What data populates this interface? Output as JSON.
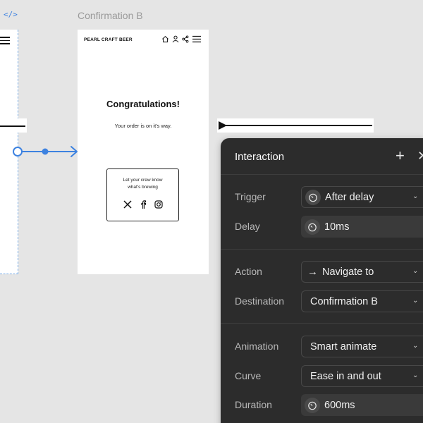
{
  "canvas": {
    "code_icon": "</>",
    "frame_label": "Confirmation B"
  },
  "phone": {
    "brand": "PEARL CRAFT BEER",
    "title": "Congratulations!",
    "subtitle": "Your order is on it's way.",
    "crew_line1": "Let your crew know",
    "crew_line2": "what's brewing",
    "nav_icons": [
      "home-icon",
      "user-icon",
      "share-icon",
      "menu-icon"
    ],
    "social_icons": [
      "x-icon",
      "facebook-icon",
      "instagram-icon"
    ]
  },
  "panel": {
    "title": "Interaction",
    "rows": {
      "trigger": {
        "label": "Trigger",
        "value": "After delay"
      },
      "delay": {
        "label": "Delay",
        "value": "10ms"
      },
      "action": {
        "label": "Action",
        "value": "Navigate to"
      },
      "destination": {
        "label": "Destination",
        "value": "Confirmation B"
      },
      "animation": {
        "label": "Animation",
        "value": "Smart animate"
      },
      "curve": {
        "label": "Curve",
        "value": "Ease in and out"
      },
      "duration": {
        "label": "Duration",
        "value": "600ms"
      }
    }
  },
  "colors": {
    "accent": "#3d82e0",
    "panel_bg": "#2c2c2c",
    "canvas_bg": "#e5e5e5"
  }
}
